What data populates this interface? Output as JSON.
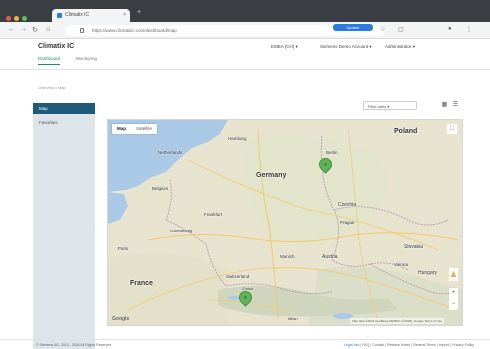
{
  "browser": {
    "tab_title": "Climatix IC",
    "url": "https://www.climatixic.com/dashboard/map",
    "update_label": "Update",
    "colors": {
      "update": "#2a7ae2",
      "dots": [
        "#e85a4f",
        "#f1b33f",
        "#5fc055"
      ]
    }
  },
  "app": {
    "title": "Climatix IC",
    "header_dropdowns": [
      "EMEA (CH)",
      "Siemens Demo Account",
      "Administrator"
    ],
    "tabs": [
      {
        "label": "Dashboard",
        "active": true
      },
      {
        "label": "Monitoring",
        "active": false
      }
    ],
    "breadcrumb": "Overview  /  Map",
    "sidebar": {
      "active_item": "Map",
      "items": [
        "Map",
        "Favorites"
      ]
    },
    "map_controls": {
      "select_value": "Filter sites"
    },
    "accent": "#1f8f7a"
  },
  "map": {
    "type_buttons": [
      "Map",
      "Satellite"
    ],
    "selected_type": "Map",
    "labels": {
      "poland": "Poland",
      "germany": "Germany",
      "france": "France",
      "netherlands": "Netherlands",
      "belgium": "Belgium",
      "switzerland": "Switzerland",
      "czechia": "Czechia",
      "austria": "Austria",
      "slovakia": "Slovakia",
      "hungary": "Hungary",
      "berlin": "Berlin",
      "hamburg": "Hamburg",
      "prague": "Prague",
      "vienna": "Vienna",
      "munich": "Munich",
      "frankfurt": "Frankfurt",
      "luxembourg": "Luxembourg",
      "paris": "Paris",
      "zurich": "Zürich",
      "milan": "Milan"
    },
    "logo": "Google",
    "attribution": "Map data ©2024 GeoBasis-DE/BKG (©2009), Google  Terms of Use"
  },
  "footer": {
    "left": "© Siemens AG, 2013 - 2024  All Rights Reserved",
    "right_accent": "Legal Info",
    "right_rest": "| FAQ | Contact | Release Notes | General Terms | Imprint | Privacy Policy"
  }
}
